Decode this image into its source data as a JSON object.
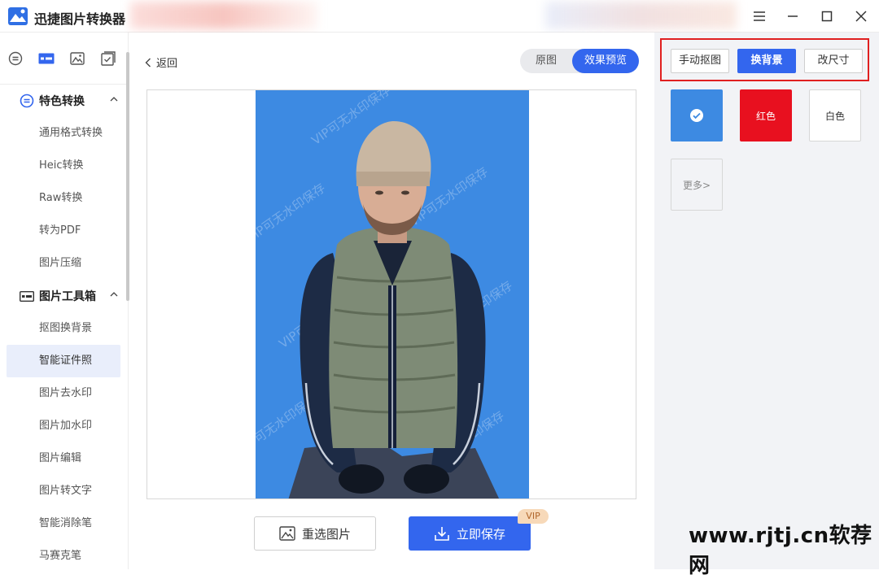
{
  "app": {
    "title": "迅捷图片转换器"
  },
  "sidebar": {
    "groups": [
      {
        "label": "特色转换",
        "items": [
          "通用格式转换",
          "Heic转换",
          "Raw转换",
          "转为PDF",
          "图片压缩"
        ]
      },
      {
        "label": "图片工具箱",
        "items": [
          "抠图换背景",
          "智能证件照",
          "图片去水印",
          "图片加水印",
          "图片编辑",
          "图片转文字",
          "智能消除笔",
          "马赛克笔"
        ]
      }
    ],
    "active_item": "智能证件照"
  },
  "main": {
    "back_label": "返回",
    "toggle": {
      "original": "原图",
      "preview": "效果预览",
      "selected": "效果预览"
    },
    "image_watermark": "VIP可无水印保存",
    "reselect_label": "重选图片",
    "save_label": "立即保存",
    "vip_badge": "VIP"
  },
  "right_panel": {
    "tools": [
      "手动抠图",
      "换背景",
      "改尺寸"
    ],
    "active_tool": "换背景",
    "colors": [
      {
        "label": "",
        "color": "#3d8ae2",
        "selected": true
      },
      {
        "label": "红色",
        "color": "#e8101f",
        "selected": false
      },
      {
        "label": "白色",
        "color": "#ffffff",
        "selected": false
      }
    ],
    "more_label": "更多>"
  },
  "site_watermark": "www.rjtj.cn软荐网",
  "colors": {
    "accent": "#3366ee",
    "photo_bg": "#3d8ae2",
    "red": "#e8101f"
  }
}
